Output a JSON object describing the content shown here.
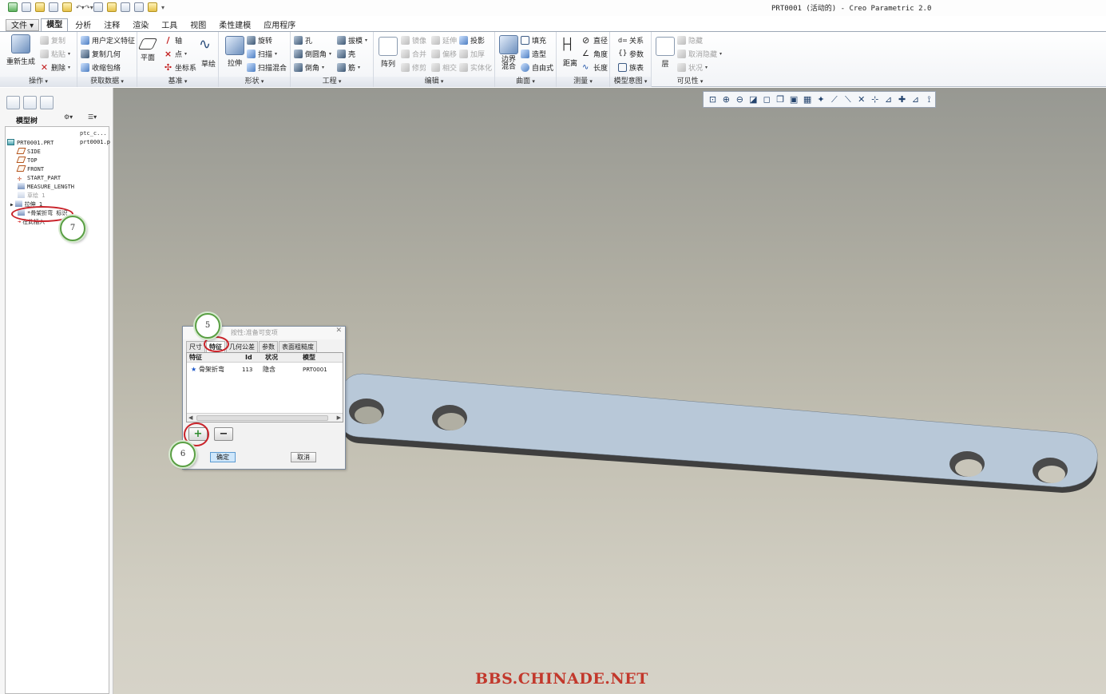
{
  "window": {
    "title": "PRT0001 (活动的) - Creo Parametric 2.0"
  },
  "tabs": [
    "文件",
    "模型",
    "分析",
    "注释",
    "渲染",
    "工具",
    "视图",
    "柔性建模",
    "应用程序"
  ],
  "ribbon": {
    "operations": {
      "label": "操作",
      "regenerate": "重新生成",
      "copy": "复制",
      "paste": "粘贴",
      "delete": "删除"
    },
    "get_data": {
      "label": "获取数据",
      "udf": "用户定义特征",
      "copy_geom": "复制几何",
      "shrinkwrap": "收缩包络"
    },
    "datum": {
      "label": "基准",
      "plane": "平面",
      "axis": "轴",
      "point": "点",
      "csys": "坐标系",
      "sketch": "草绘"
    },
    "shapes": {
      "label": "形状",
      "extrude": "拉伸",
      "revolve": "旋转",
      "sweep": "扫描",
      "swept_blend": "扫描混合"
    },
    "engineering": {
      "label": "工程",
      "hole": "孔",
      "round": "倒圆角",
      "chamfer": "倒角",
      "draft": "拔模",
      "shell": "壳",
      "rib": "筋"
    },
    "editing": {
      "label": "编辑",
      "pattern": "阵列",
      "mirror": "镜像",
      "merge": "合并",
      "trim": "修剪",
      "extend": "延伸",
      "offset": "偏移",
      "intersect": "相交",
      "project": "投影",
      "thicken": "加厚",
      "solidify": "实体化"
    },
    "surfaces": {
      "label": "曲面",
      "boundary": "边界混合",
      "fill": "填充",
      "style": "造型",
      "freestyle": "自由式"
    },
    "measure": {
      "label": "测量",
      "distance": "距离",
      "diameter": "直径",
      "angle": "角度",
      "length": "长度"
    },
    "model_intent": {
      "label": "模型意图",
      "relations": "关系",
      "parameters": "参数",
      "family_table": "族表"
    },
    "visibility": {
      "label": "可见性",
      "layers": "层",
      "hide": "隐藏",
      "unhide": "取消隐藏",
      "status": "状况"
    }
  },
  "model_tree": {
    "title": "模型树",
    "column_header": "ptc_c...",
    "items": [
      {
        "label": "PRT0001.PRT",
        "col": "prt0001.p"
      },
      {
        "label": "SIDE"
      },
      {
        "label": "TOP"
      },
      {
        "label": "FRONT"
      },
      {
        "label": "START_PART"
      },
      {
        "label": "MEASURE_LENGTH"
      },
      {
        "label": "草绘 1"
      },
      {
        "label": "拉伸 1"
      },
      {
        "label": "*骨架折弯 标识"
      },
      {
        "label": "在此插入"
      }
    ]
  },
  "dialog": {
    "title": "按性:准备可变项",
    "tabs": [
      "尺寸",
      "特征",
      "几何公差",
      "参数",
      "表面粗糙度"
    ],
    "columns": [
      "特征",
      "Id",
      "状况",
      "模型"
    ],
    "rows": [
      {
        "feature": "骨架折弯",
        "id": "113",
        "status": "隐含",
        "model": "PRT0001"
      }
    ],
    "ok": "确定",
    "cancel": "取消",
    "add": "+",
    "remove": "−"
  },
  "callouts": [
    "5",
    "6",
    "7"
  ],
  "watermark": "BBS.CHINADE.NET",
  "colors": {
    "part_face": "#b8c8d8",
    "part_edge": "#4a4a4a",
    "callout_border": "#5a9f44",
    "highlight_ring": "#c9232a",
    "watermark": "#c2382c"
  }
}
